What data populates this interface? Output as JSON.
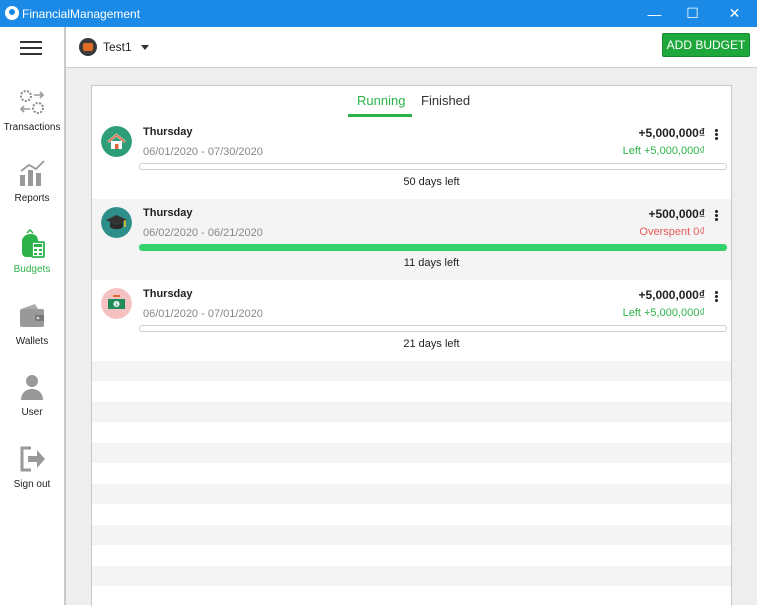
{
  "window": {
    "title": "FinancialManagement",
    "minimize": "—",
    "maximize": "☐",
    "close": "✕"
  },
  "sidebar": {
    "items": [
      {
        "label": "Transactions",
        "icon": "transactions-icon"
      },
      {
        "label": "Reports",
        "icon": "reports-icon"
      },
      {
        "label": "Budgets",
        "icon": "budgets-icon",
        "active": true
      },
      {
        "label": "Wallets",
        "icon": "wallets-icon"
      },
      {
        "label": "User",
        "icon": "user-icon"
      },
      {
        "label": "Sign out",
        "icon": "sign-out-icon"
      }
    ]
  },
  "topbar": {
    "wallet_name": "Test1",
    "add_budget_label": "ADD BUDGET"
  },
  "tabs": {
    "running": "Running",
    "finished": "Finished",
    "active": "running"
  },
  "budgets": [
    {
      "day": "Thursday",
      "dates": "06/01/2020 - 07/30/2020",
      "amount": "+5,000,000₫",
      "remaining": "Left +5,000,000₫",
      "status": "left",
      "progress": 0.0,
      "days_left": "50 days left",
      "icon": "home-icon",
      "color": "#2e9e7a"
    },
    {
      "day": "Thursday",
      "dates": "06/02/2020 - 06/21/2020",
      "amount": "+500,000₫",
      "remaining": "Overspent 0₫",
      "status": "overspent",
      "progress": 1.0,
      "days_left": "11 days left",
      "icon": "graduation-cap-icon",
      "color": "#2e8f8a"
    },
    {
      "day": "Thursday",
      "dates": "06/01/2020 - 07/01/2020",
      "amount": "+5,000,000₫",
      "remaining": "Left +5,000,000₫",
      "status": "left",
      "progress": 0.0,
      "days_left": "21 days left",
      "icon": "money-icon",
      "color": "#f6c1c1"
    }
  ],
  "colors": {
    "accent": "#2db34a",
    "titlebar": "#1a8ae6",
    "left_text": "#2db34a",
    "overspent_text": "#e85a5a"
  }
}
